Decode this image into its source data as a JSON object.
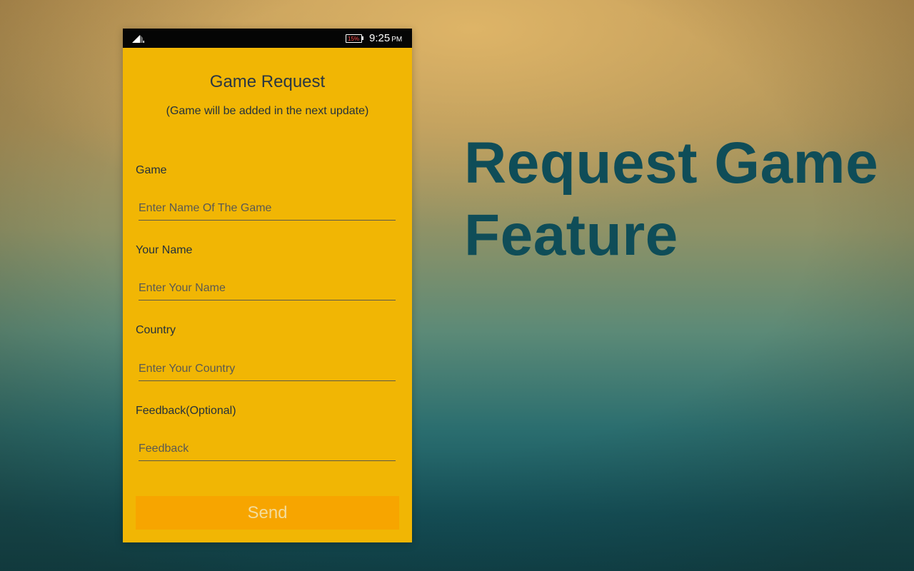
{
  "status_bar": {
    "battery": "15%",
    "time": "9:25",
    "ampm": "PM"
  },
  "form": {
    "title": "Game Request",
    "subtitle": "(Game will be added in the next update)",
    "fields": [
      {
        "label": "Game",
        "placeholder": "Enter Name Of The Game"
      },
      {
        "label": "Your Name",
        "placeholder": "Enter Your Name"
      },
      {
        "label": "Country",
        "placeholder": "Enter Your Country"
      },
      {
        "label": "Feedback(Optional)",
        "placeholder": "Feedback"
      }
    ],
    "send_label": "Send"
  },
  "headline": {
    "line1": "Request Game",
    "line2": "Feature"
  },
  "colors": {
    "form_background": "#f1b604",
    "send_button": "#f7a500",
    "headline_text": "#0f4d58"
  },
  "icons": [
    "signal-icon",
    "battery-icon"
  ]
}
